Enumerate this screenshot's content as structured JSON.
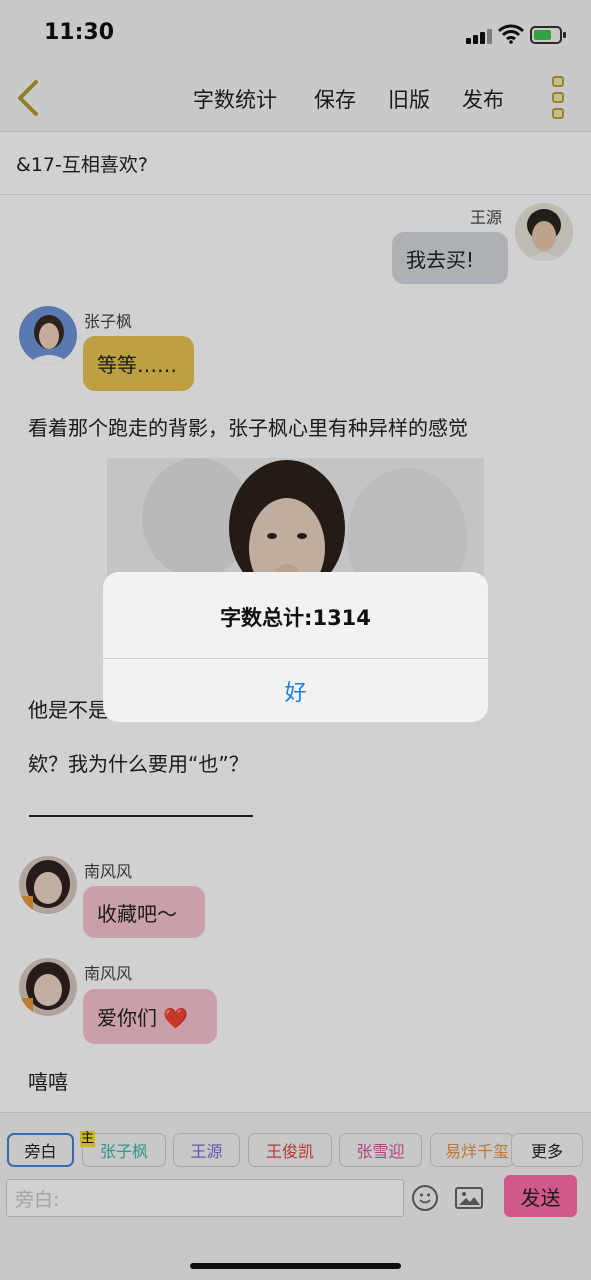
{
  "status_bar": {
    "time": "11:30"
  },
  "nav": {
    "items": [
      "字数统计",
      "保存",
      "旧版",
      "发布"
    ]
  },
  "chapter": {
    "title": "&17-互相喜欢?"
  },
  "messages": [
    {
      "speaker": "王源",
      "text": "我去买!",
      "side": "right",
      "bubble_color": "#d4d8de"
    },
    {
      "speaker": "张子枫",
      "text": "等等……",
      "side": "left",
      "bubble_color": "#e7c453"
    }
  ],
  "narration": [
    "看着那个跑走的背影，张子枫心里有种异样的感觉",
    "他是不是",
    "欸？我为什么要用“也”？"
  ],
  "messages2": [
    {
      "speaker": "南风风",
      "text": "收藏吧～",
      "bubble_color": "#f7c2cf"
    },
    {
      "speaker": "南风风",
      "text": "爱你们 ❤️",
      "bubble_color": "#f7c2cf"
    }
  ],
  "closing_narration": "嘻嘻",
  "bottom": {
    "host_tag": "主",
    "chips": [
      {
        "label": "旁白",
        "color": "#222222",
        "selected": true
      },
      {
        "label": "张子枫",
        "color": "#3fb7a8"
      },
      {
        "label": "王源",
        "color": "#7d67d0"
      },
      {
        "label": "王俊凯",
        "color": "#d9453e"
      },
      {
        "label": "张雪迎",
        "color": "#d9549a"
      },
      {
        "label": "易烊千玺",
        "color": "#e0954a"
      }
    ],
    "more_label": "更多",
    "input_placeholder": "旁白:",
    "send_label": "发送"
  },
  "alert": {
    "title": "字数总计:1314",
    "ok_label": "好"
  }
}
